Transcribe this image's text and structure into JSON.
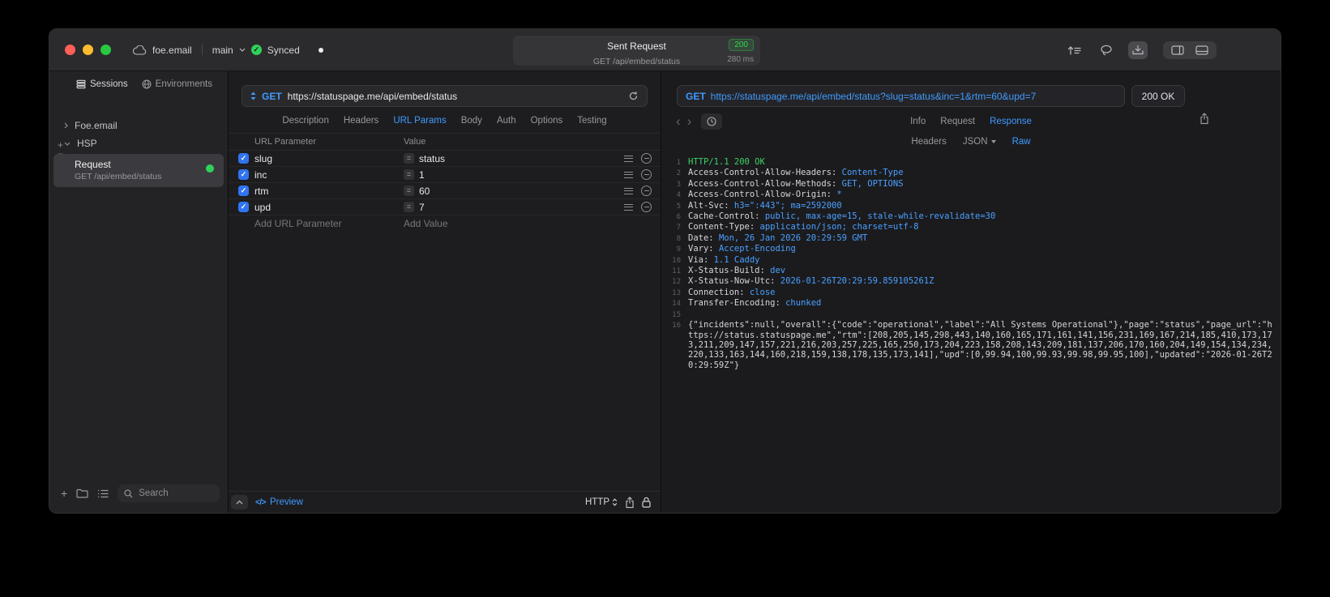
{
  "titlebar": {
    "project": "foe.email",
    "branch": "main",
    "sync_label": "Synced",
    "center": {
      "title": "Sent Request",
      "status_code": "200",
      "subtitle": "GET /api/embed/status",
      "duration": "280 ms"
    }
  },
  "sidebar": {
    "tabs": [
      {
        "label": "Sessions"
      },
      {
        "label": "Environments"
      }
    ],
    "active_tab": "Sessions",
    "tree": [
      {
        "label": "Foe.email",
        "expanded": false
      },
      {
        "label": "HSP",
        "expanded": true
      }
    ],
    "request_item": {
      "title": "Request",
      "subtitle": "GET /api/embed/status"
    },
    "search_placeholder": "Search"
  },
  "request": {
    "method": "GET",
    "url": "https://statuspage.me/api/embed/status",
    "tabs": [
      "Description",
      "Headers",
      "URL Params",
      "Body",
      "Auth",
      "Options",
      "Testing"
    ],
    "active_tab": "URL Params",
    "params": {
      "columns": [
        "URL Parameter",
        "Value"
      ],
      "rows": [
        {
          "enabled": true,
          "name": "slug",
          "value": "status"
        },
        {
          "enabled": true,
          "name": "inc",
          "value": "1"
        },
        {
          "enabled": true,
          "name": "rtm",
          "value": "60"
        },
        {
          "enabled": true,
          "name": "upd",
          "value": "7"
        }
      ],
      "add_name_placeholder": "Add URL Parameter",
      "add_value_placeholder": "Add Value"
    },
    "footer": {
      "preview_icon_glyph": "</>",
      "preview_label": "Preview",
      "protocol_label": "HTTP"
    }
  },
  "response": {
    "method": "GET",
    "url": "https://statuspage.me/api/embed/status?slug=status&inc=1&rtm=60&upd=7",
    "status": "200 OK",
    "tabs": [
      "Info",
      "Request",
      "Response"
    ],
    "active_tab": "Response",
    "subtabs": [
      "Headers",
      "JSON",
      "Raw"
    ],
    "active_subtab": "Raw",
    "content": {
      "status_line": "HTTP/1.1 200 OK",
      "headers": [
        {
          "name": "Access-Control-Allow-Headers",
          "value": "Content-Type"
        },
        {
          "name": "Access-Control-Allow-Methods",
          "value": "GET, OPTIONS"
        },
        {
          "name": "Access-Control-Allow-Origin",
          "value": "*"
        },
        {
          "name": "Alt-Svc",
          "value": "h3=\":443\"; ma=2592000"
        },
        {
          "name": "Cache-Control",
          "value": "public, max-age=15, stale-while-revalidate=30"
        },
        {
          "name": "Content-Type",
          "value": "application/json; charset=utf-8"
        },
        {
          "name": "Date",
          "value": "Mon, 26 Jan 2026 20:29:59 GMT"
        },
        {
          "name": "Vary",
          "value": "Accept-Encoding"
        },
        {
          "name": "Via",
          "value": "1.1 Caddy"
        },
        {
          "name": "X-Status-Build",
          "value": "dev"
        },
        {
          "name": "X-Status-Now-Utc",
          "value": "2026-01-26T20:29:59.859105261Z"
        },
        {
          "name": "Connection",
          "value": "close"
        },
        {
          "name": "Transfer-Encoding",
          "value": "chunked"
        }
      ],
      "body": "{\"incidents\":null,\"overall\":{\"code\":\"operational\",\"label\":\"All Systems Operational\"},\"page\":\"status\",\"page_url\":\"https://status.statuspage.me\",\"rtm\":[208,205,145,298,443,140,160,165,171,161,141,156,231,169,167,214,185,410,173,173,211,209,147,157,221,216,203,257,225,165,250,173,204,223,158,208,143,209,181,137,206,170,160,204,149,154,134,234,220,133,163,144,160,218,159,138,178,135,173,141],\"upd\":[0,99.94,100,99.93,99.98,99.95,100],\"updated\":\"2026-01-26T20:29:59Z\"}"
    }
  },
  "colors": {
    "accent_blue": "#3f9bff",
    "status_green": "#32d74b"
  }
}
